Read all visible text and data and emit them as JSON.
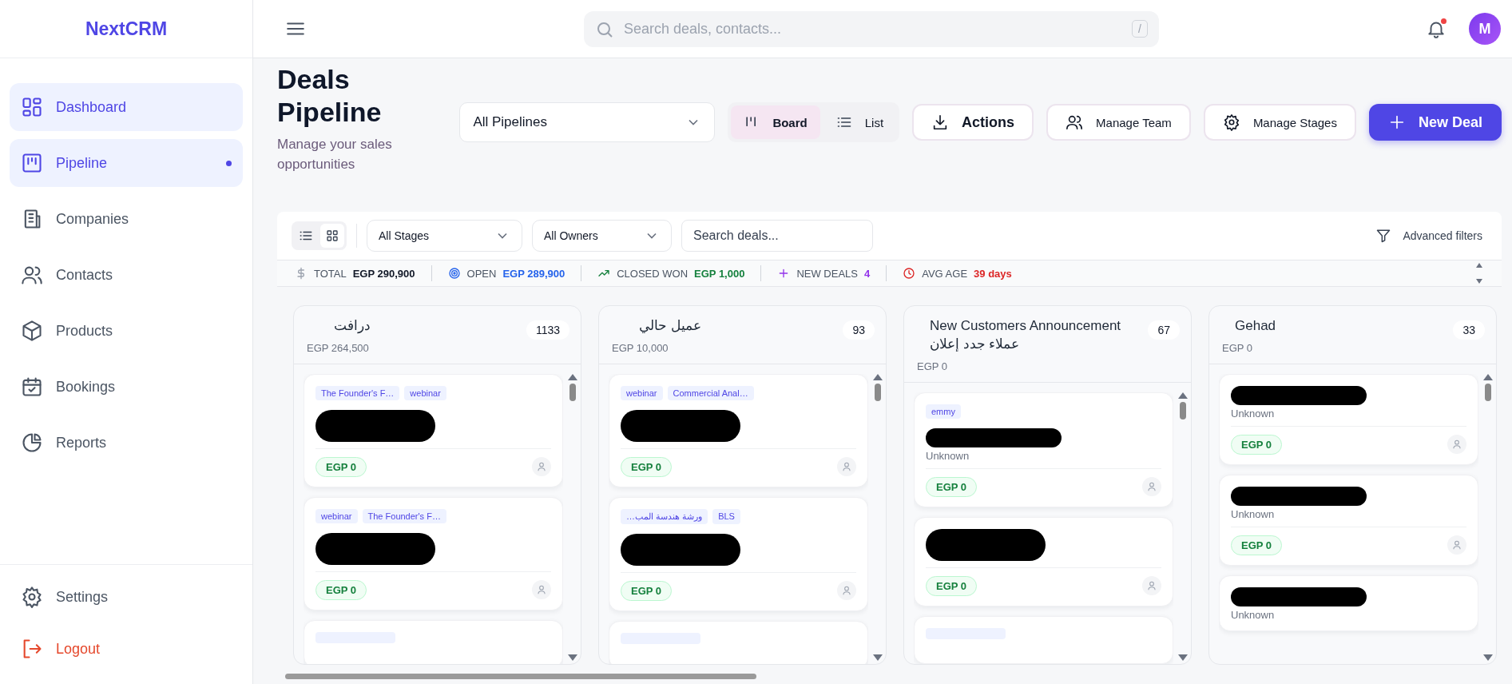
{
  "sidebar": {
    "logo": "NextCRM",
    "items": [
      {
        "label": "Dashboard",
        "kind": "dashboard",
        "selected": true,
        "indicator": false
      },
      {
        "label": "Pipeline",
        "kind": "pipeline",
        "selected": true,
        "indicator": true
      },
      {
        "label": "Companies",
        "kind": "companies",
        "selected": false,
        "indicator": false
      },
      {
        "label": "Contacts",
        "kind": "contacts",
        "selected": false,
        "indicator": false
      },
      {
        "label": "Products",
        "kind": "products",
        "selected": false,
        "indicator": false
      },
      {
        "label": "Bookings",
        "kind": "bookings",
        "selected": false,
        "indicator": false
      },
      {
        "label": "Reports",
        "kind": "reports",
        "selected": false,
        "indicator": false
      }
    ],
    "footer_items": [
      {
        "label": "Settings",
        "kind": "settings"
      },
      {
        "label": "Logout",
        "kind": "logout"
      }
    ]
  },
  "topbar": {
    "search": {
      "placeholder": "Search deals, contacts...",
      "shortcut": "/"
    },
    "notification_dot": true,
    "avatar": "M"
  },
  "header": {
    "title": "Deals Pipeline",
    "subtitle": "Manage your sales opportunities",
    "pipeline_select": "All Pipelines",
    "views": [
      {
        "label": "Board",
        "kind": "board",
        "selected": true
      },
      {
        "label": "List",
        "kind": "list",
        "selected": false
      }
    ],
    "buttons": [
      {
        "label": "Actions",
        "kind": "download"
      },
      {
        "label": "Manage Team",
        "kind": "team"
      },
      {
        "label": "Manage Stages",
        "kind": "gear"
      },
      {
        "label": "New Deal",
        "kind": "primary"
      }
    ]
  },
  "filters": {
    "layout_toggle": [
      {
        "kind": "list",
        "selected": false
      },
      {
        "kind": "grid",
        "selected": true
      }
    ],
    "stage_select": "All Stages",
    "owner_select": "All Owners",
    "search": {
      "placeholder": "Search deals..."
    },
    "advanced": "Advanced filters"
  },
  "stats": [
    {
      "kind": "total",
      "label": "TOTAL",
      "value": "EGP 290,900",
      "color": "#111827"
    },
    {
      "kind": "open",
      "label": "OPEN",
      "value": "EGP 289,900",
      "color": "#2563eb"
    },
    {
      "kind": "won",
      "label": "CLOSED WON",
      "value": "EGP 1,000",
      "color": "#15803d"
    },
    {
      "kind": "new",
      "label": "NEW DEALS",
      "value": "4",
      "color": "#9333ea"
    },
    {
      "kind": "age",
      "label": "AVG AGE",
      "value": "39 days",
      "color": "#dc2626"
    }
  ],
  "columns": [
    {
      "title": "درافت",
      "total": "EGP 264,500",
      "count": "1133",
      "cards": [
        {
          "kind": "deal",
          "tags": [
            "The Founder's F…",
            "webinar"
          ],
          "redacted": true,
          "amount": "EGP 0"
        },
        {
          "kind": "deal",
          "tags": [
            "webinar",
            "The Founder's F…"
          ],
          "redacted": true,
          "amount": "EGP 0"
        },
        {
          "kind": "cut"
        }
      ]
    },
    {
      "title": "عميل حالي",
      "total": "EGP 10,000",
      "count": "93",
      "cards": [
        {
          "kind": "deal",
          "tags": [
            "webinar",
            "Commercial Anal…"
          ],
          "redacted": true,
          "amount": "EGP 0"
        },
        {
          "kind": "deal",
          "tags": [
            "ورشة هندسة المب…",
            "BLS"
          ],
          "redacted": true,
          "amount": "EGP 0"
        },
        {
          "kind": "cut"
        }
      ]
    },
    {
      "title": "New Customers Announcement عملاء جدد إعلان",
      "total": "EGP 0",
      "count": "67",
      "cards": [
        {
          "kind": "deal",
          "tags": [
            "emmy"
          ],
          "redacted": true,
          "subtitle": "Unknown",
          "amount": "EGP 0"
        },
        {
          "kind": "deal",
          "redacted": true,
          "amount": "EGP 0"
        },
        {
          "kind": "cut"
        }
      ]
    },
    {
      "title": "Gehad",
      "total": "EGP 0",
      "count": "33",
      "cards": [
        {
          "kind": "deal",
          "redacted": true,
          "subtitle": "Unknown",
          "amount": "EGP 0"
        },
        {
          "kind": "deal",
          "redacted": true,
          "subtitle": "Unknown",
          "amount": "EGP 0"
        },
        {
          "kind": "deal",
          "redacted": true,
          "subtitle": "Unknown"
        }
      ]
    }
  ]
}
